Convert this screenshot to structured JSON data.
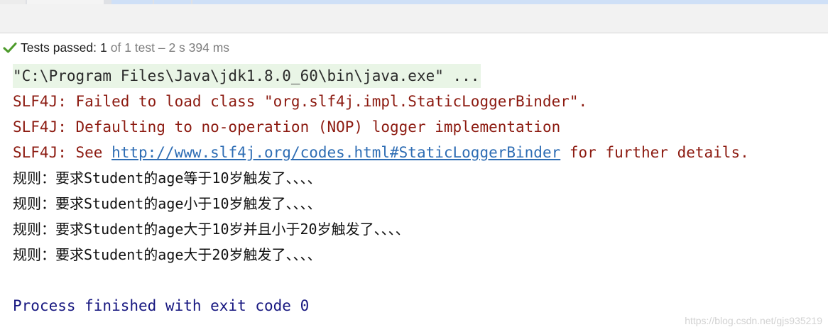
{
  "status": {
    "passed_label": "Tests passed:",
    "passed_count": "1",
    "detail": "of 1 test – 2 s 394 ms"
  },
  "console": {
    "command": "\"C:\\Program Files\\Java\\jdk1.8.0_60\\bin\\java.exe\" ...",
    "errors": [
      "SLF4J: Failed to load class \"org.slf4j.impl.StaticLoggerBinder\".",
      "SLF4J: Defaulting to no-operation (NOP) logger implementation"
    ],
    "see_prefix": "SLF4J: See ",
    "see_link": "http://www.slf4j.org/codes.html#StaticLoggerBinder",
    "see_suffix": " for further details.",
    "output": [
      "规则：要求Student的age等于10岁触发了、、、、",
      "规则：要求Student的age小于10岁触发了、、、、",
      "规则：要求Student的age大于10岁并且小于20岁触发了、、、、",
      "规则：要求Student的age大于20岁触发了、、、、"
    ],
    "exit": "Process finished with exit code 0"
  },
  "watermark": "https://blog.csdn.net/gjs935219",
  "colors": {
    "pass_green": "#4c9a2a",
    "error_red": "#8c1a10",
    "link_blue": "#2e6db4",
    "exit_navy": "#171780"
  },
  "icons": {
    "status_icon": "check-icon"
  }
}
